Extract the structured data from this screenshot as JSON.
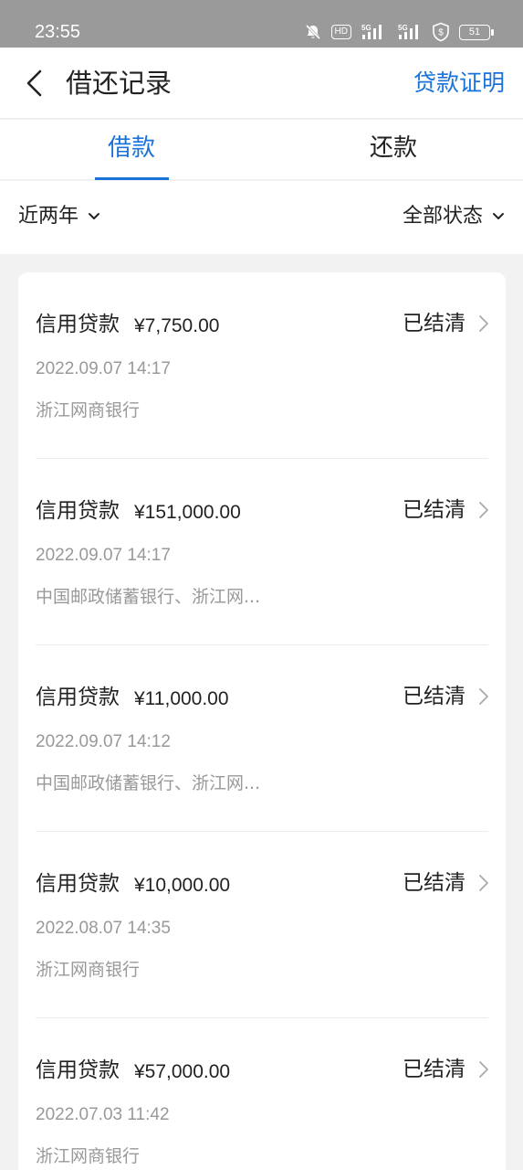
{
  "status_bar": {
    "time": "23:55",
    "icons": [
      "bell-off-icon",
      "hd-icon",
      "signal-5g-icon",
      "signal-5g-icon",
      "shield-icon",
      "battery-icon"
    ],
    "hd": "HD",
    "net1": "5G",
    "net2": "5G",
    "battery": "51"
  },
  "nav": {
    "title": "借还记录",
    "action": "贷款证明"
  },
  "tabs": [
    {
      "label": "借款",
      "active": true
    },
    {
      "label": "还款",
      "active": false
    }
  ],
  "filters": {
    "period": "近两年",
    "status": "全部状态"
  },
  "records": [
    {
      "type": "信用贷款",
      "amount": "¥7,750.00",
      "status": "已结清",
      "time": "2022.09.07 14:17",
      "bank": "浙江网商银行"
    },
    {
      "type": "信用贷款",
      "amount": "¥151,000.00",
      "status": "已结清",
      "time": "2022.09.07 14:17",
      "bank": "中国邮政储蓄银行、浙江网..."
    },
    {
      "type": "信用贷款",
      "amount": "¥11,000.00",
      "status": "已结清",
      "time": "2022.09.07 14:12",
      "bank": "中国邮政储蓄银行、浙江网..."
    },
    {
      "type": "信用贷款",
      "amount": "¥10,000.00",
      "status": "已结清",
      "time": "2022.08.07 14:35",
      "bank": "浙江网商银行"
    },
    {
      "type": "信用贷款",
      "amount": "¥57,000.00",
      "status": "已结清",
      "time": "2022.07.03 11:42",
      "bank": "浙江网商银行"
    }
  ],
  "colors": {
    "accent": "#1a73d9",
    "text": "#222222",
    "muted": "#999999",
    "background": "#f2f2f2"
  }
}
